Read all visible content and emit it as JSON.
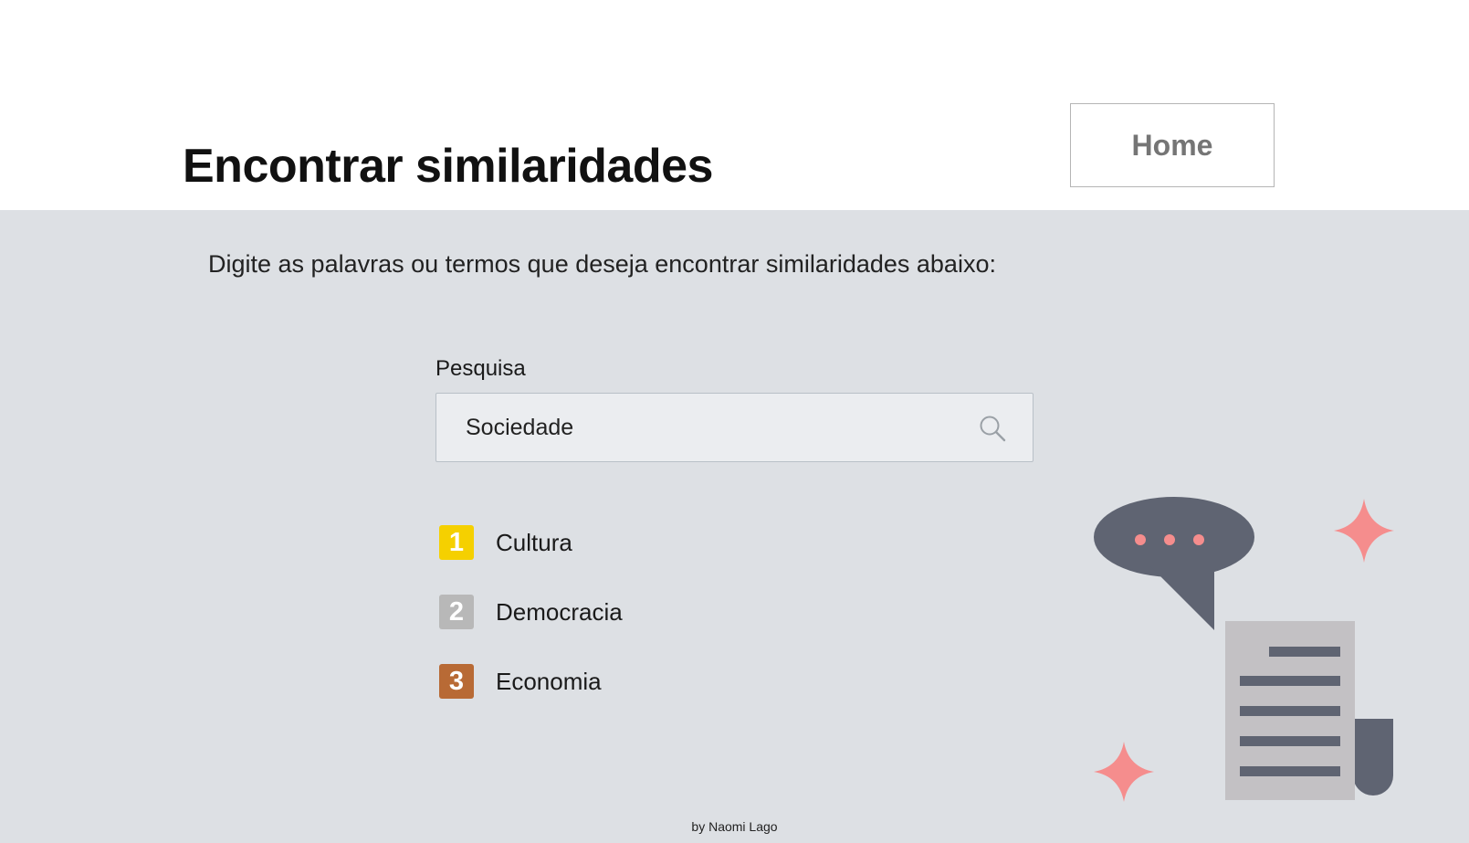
{
  "header": {
    "title": "Encontrar similaridades",
    "home_label": "Home"
  },
  "main": {
    "instructions": "Digite as palavras ou termos que deseja encontrar similaridades abaixo:",
    "search": {
      "label": "Pesquisa",
      "value": "Sociedade",
      "icon": "search-icon"
    },
    "results": [
      {
        "rank": "1",
        "label": "Cultura",
        "color": "#f5d000"
      },
      {
        "rank": "2",
        "label": "Democracia",
        "color": "#b8b8b8"
      },
      {
        "rank": "3",
        "label": "Economia",
        "color": "#b86a35"
      }
    ],
    "illustration": {
      "icons": [
        "speech-bubble-icon",
        "document-scroll-icon",
        "sparkle-icon"
      ],
      "bubble_color": "#5f6472",
      "sparkle_color": "#f58d8d",
      "paper_color": "#c3c1c4"
    }
  },
  "footer": {
    "credit": "by Naomi Lago"
  }
}
